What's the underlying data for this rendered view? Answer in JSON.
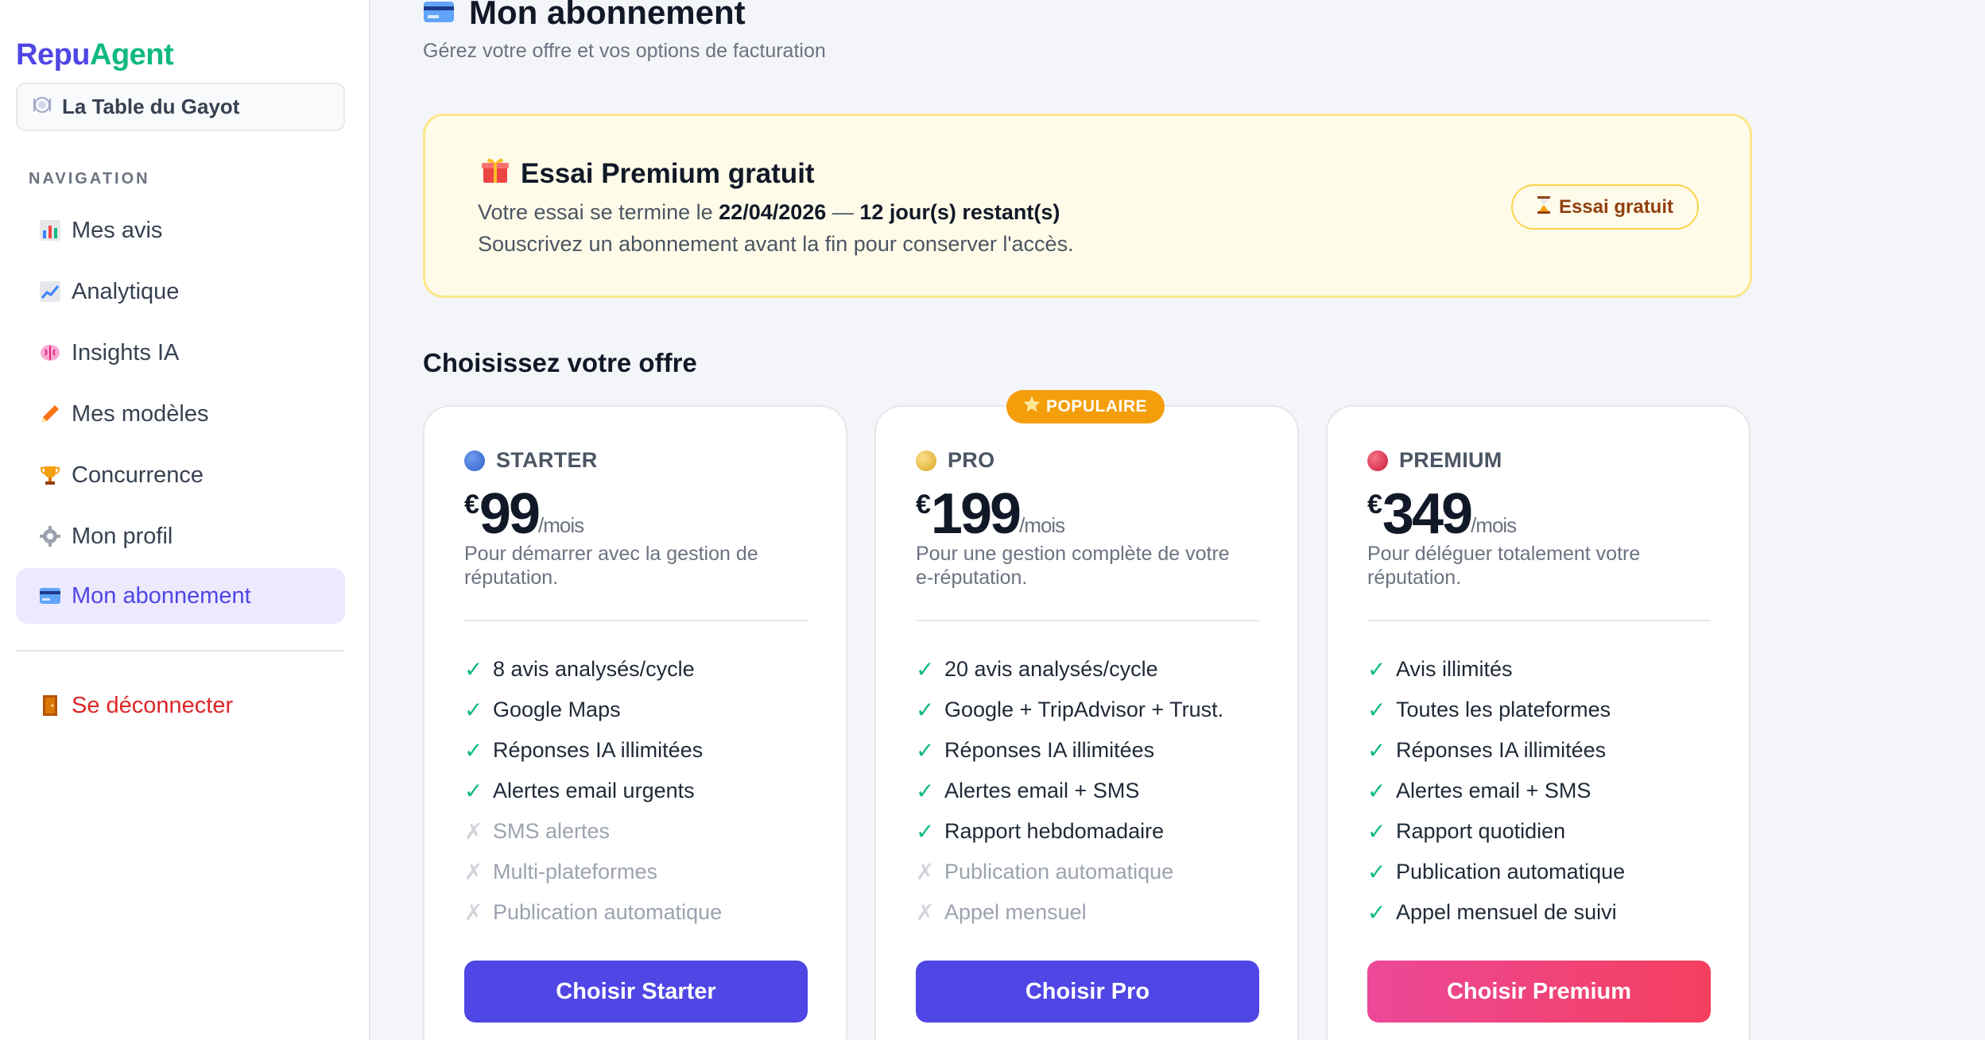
{
  "app": {
    "logo_part1": "Repu",
    "logo_part2": "Agent"
  },
  "restaurant": {
    "name": "La Table du Gayot",
    "icon": "plate-icon"
  },
  "sidebar": {
    "heading": "NAVIGATION",
    "items": [
      {
        "label": "Mes avis",
        "icon": "bar-chart-icon",
        "active": false
      },
      {
        "label": "Analytique",
        "icon": "trend-chart-icon",
        "active": false
      },
      {
        "label": "Insights IA",
        "icon": "brain-icon",
        "active": false
      },
      {
        "label": "Mes modèles",
        "icon": "pencil-icon",
        "active": false
      },
      {
        "label": "Concurrence",
        "icon": "trophy-icon",
        "active": false
      },
      {
        "label": "Mon profil",
        "icon": "gear-icon",
        "active": false
      },
      {
        "label": "Mon abonnement",
        "icon": "credit-card-icon",
        "active": true
      }
    ],
    "logout": "Se déconnecter"
  },
  "page": {
    "title": "Mon abonnement",
    "subtitle": "Gérez votre offre et vos options de facturation"
  },
  "trial": {
    "title": "Essai Premium gratuit",
    "line1_prefix": "Votre essai se termine le ",
    "end_date": "22/04/2026",
    "separator": " — ",
    "days_left": "12 jour(s) restant(s)",
    "line2": "Souscrivez un abonnement avant la fin pour conserver l'accès.",
    "badge": "Essai gratuit"
  },
  "plans_section": {
    "title": "Choisissez votre offre",
    "popular_badge": "POPULAIRE"
  },
  "plans": [
    {
      "name": "STARTER",
      "dot_color": "#3b6fd6",
      "currency": "€",
      "price": "99",
      "period": "/mois",
      "description": "Pour démarrer avec la gestion de réputation.",
      "features": [
        {
          "label": "8 avis analysés/cycle",
          "included": true
        },
        {
          "label": "Google Maps",
          "included": true
        },
        {
          "label": "Réponses IA illimitées",
          "included": true
        },
        {
          "label": "Alertes email urgents",
          "included": true
        },
        {
          "label": "SMS alertes",
          "included": false
        },
        {
          "label": "Multi-plateformes",
          "included": false
        },
        {
          "label": "Publication automatique",
          "included": false
        }
      ],
      "cta": "Choisir Starter"
    },
    {
      "name": "PRO",
      "dot_color": "#e8b93a",
      "currency": "€",
      "price": "199",
      "period": "/mois",
      "description": "Pour une gestion complète de votre e-réputation.",
      "features": [
        {
          "label": "20 avis analysés/cycle",
          "included": true
        },
        {
          "label": "Google + TripAdvisor + Trust.",
          "included": true
        },
        {
          "label": "Réponses IA illimitées",
          "included": true
        },
        {
          "label": "Alertes email + SMS",
          "included": true
        },
        {
          "label": "Rapport hebdomadaire",
          "included": true
        },
        {
          "label": "Publication automatique",
          "included": false
        },
        {
          "label": "Appel mensuel",
          "included": false
        }
      ],
      "cta": "Choisir Pro"
    },
    {
      "name": "PREMIUM",
      "dot_color": "#e0314b",
      "currency": "€",
      "price": "349",
      "period": "/mois",
      "description": "Pour déléguer totalement votre réputation.",
      "features": [
        {
          "label": "Avis illimités",
          "included": true
        },
        {
          "label": "Toutes les plateformes",
          "included": true
        },
        {
          "label": "Réponses IA illimitées",
          "included": true
        },
        {
          "label": "Alertes email + SMS",
          "included": true
        },
        {
          "label": "Rapport quotidien",
          "included": true
        },
        {
          "label": "Publication automatique",
          "included": true
        },
        {
          "label": "Appel mensuel de suivi",
          "included": true
        }
      ],
      "cta": "Choisir Premium"
    }
  ],
  "marks": {
    "check": "✓",
    "cross": "✗"
  }
}
